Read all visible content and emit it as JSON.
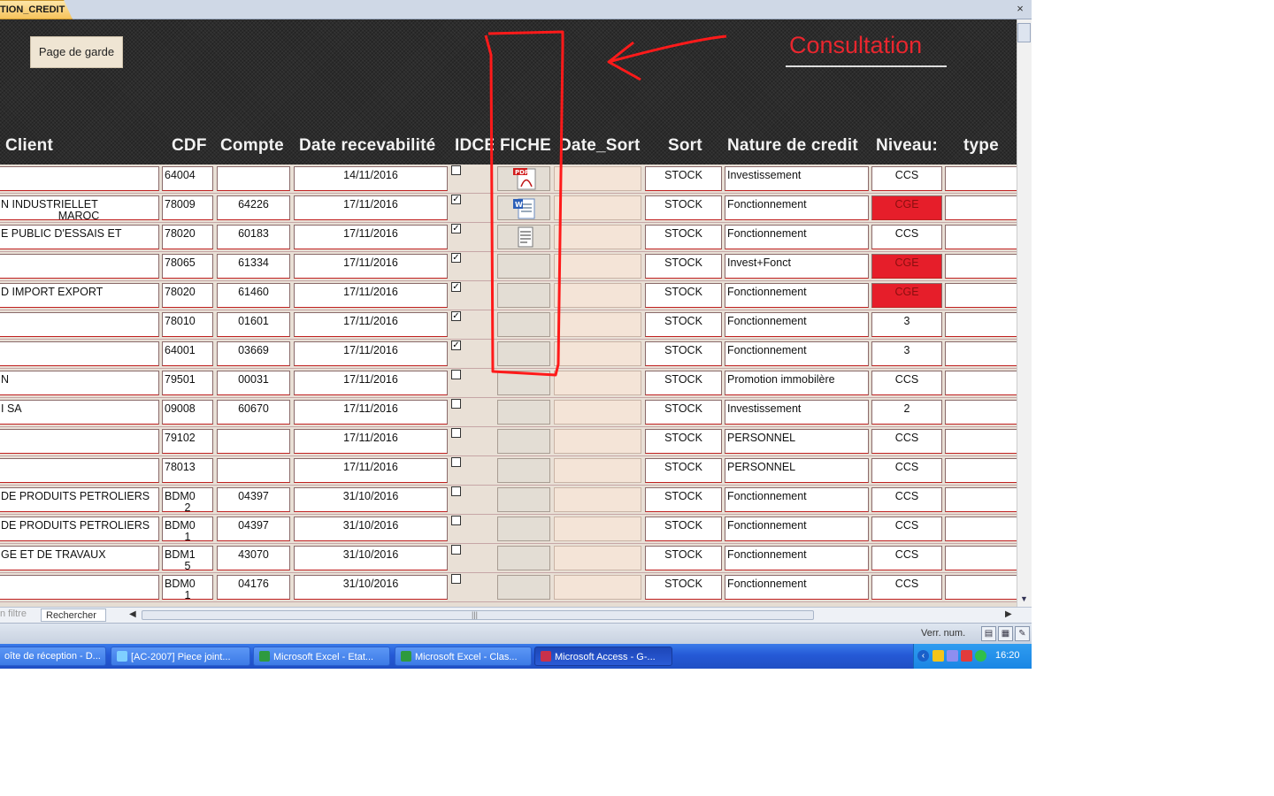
{
  "document_tab": {
    "label": "TION_CREDIT",
    "close": "×"
  },
  "form": {
    "home_button": "Page de garde",
    "annotation": "Consultation",
    "headers": [
      "Client",
      "CDF",
      "Compte",
      "Date recevabilité",
      "IDCE",
      "FICHE",
      "Date_Sort",
      "Sort",
      "Nature de credit",
      "Niveau:",
      "type"
    ],
    "rows": [
      {
        "client": "",
        "client2": "",
        "cdf": "64004",
        "cdf2": "",
        "compte": "",
        "date": "14/11/2016",
        "idce": false,
        "fiche": "pdf-icon",
        "sort": "STOCK",
        "nature": "Investissement",
        "niveau": "CCS",
        "niveau_red": false
      },
      {
        "client": "N INDUSTRIELLET",
        "client2": "MAROC",
        "cdf": "78009",
        "cdf2": "",
        "compte": "64226",
        "date": "17/11/2016",
        "idce": true,
        "fiche": "word-icon",
        "sort": "STOCK",
        "nature": "Fonctionnement",
        "niveau": "CGE",
        "niveau_red": true
      },
      {
        "client": "E PUBLIC D'ESSAIS ET",
        "client2": "",
        "cdf": "78020",
        "cdf2": "",
        "compte": "60183",
        "date": "17/11/2016",
        "idce": true,
        "fiche": "document-icon",
        "sort": "STOCK",
        "nature": "Fonctionnement",
        "niveau": "CCS",
        "niveau_red": false
      },
      {
        "client": "",
        "client2": "",
        "cdf": "78065",
        "cdf2": "",
        "compte": "61334",
        "date": "17/11/2016",
        "idce": true,
        "fiche": "",
        "sort": "STOCK",
        "nature": "Invest+Fonct",
        "niveau": "CGE",
        "niveau_red": true
      },
      {
        "client": "D IMPORT EXPORT",
        "client2": "",
        "cdf": "78020",
        "cdf2": "",
        "compte": "61460",
        "date": "17/11/2016",
        "idce": true,
        "fiche": "",
        "sort": "STOCK",
        "nature": "Fonctionnement",
        "niveau": "CGE",
        "niveau_red": true
      },
      {
        "client": "",
        "client2": "",
        "cdf": "78010",
        "cdf2": "",
        "compte": "01601",
        "date": "17/11/2016",
        "idce": true,
        "fiche": "",
        "sort": "STOCK",
        "nature": "Fonctionnement",
        "niveau": "3",
        "niveau_red": false
      },
      {
        "client": "",
        "client2": "",
        "cdf": "64001",
        "cdf2": "",
        "compte": "03669",
        "date": "17/11/2016",
        "idce": true,
        "fiche": "",
        "sort": "STOCK",
        "nature": "Fonctionnement",
        "niveau": "3",
        "niveau_red": false
      },
      {
        "client": "N",
        "client2": "",
        "cdf": "79501",
        "cdf2": "",
        "compte": "00031",
        "date": "17/11/2016",
        "idce": false,
        "fiche": "",
        "sort": "STOCK",
        "nature": "Promotion immobilère",
        "niveau": "CCS",
        "niveau_red": false
      },
      {
        "client": "I SA",
        "client2": "",
        "cdf": "09008",
        "cdf2": "",
        "compte": "60670",
        "date": "17/11/2016",
        "idce": false,
        "fiche": "",
        "sort": "STOCK",
        "nature": "Investissement",
        "niveau": "2",
        "niveau_red": false
      },
      {
        "client": "",
        "client2": "",
        "cdf": "79102",
        "cdf2": "",
        "compte": "",
        "date": "17/11/2016",
        "idce": false,
        "fiche": "",
        "sort": "STOCK",
        "nature": "PERSONNEL",
        "niveau": "CCS",
        "niveau_red": false
      },
      {
        "client": "",
        "client2": "",
        "cdf": "78013",
        "cdf2": "",
        "compte": "",
        "date": "17/11/2016",
        "idce": false,
        "fiche": "",
        "sort": "STOCK",
        "nature": "PERSONNEL",
        "niveau": "CCS",
        "niveau_red": false
      },
      {
        "client": "DE PRODUITS PETROLIERS",
        "client2": "",
        "cdf": "BDM0",
        "cdf2": "2",
        "compte": "04397",
        "date": "31/10/2016",
        "idce": false,
        "fiche": "",
        "sort": "STOCK",
        "nature": "Fonctionnement",
        "niveau": "CCS",
        "niveau_red": false
      },
      {
        "client": "DE PRODUITS PETROLIERS",
        "client2": "",
        "cdf": "BDM0",
        "cdf2": "1",
        "compte": "04397",
        "date": "31/10/2016",
        "idce": false,
        "fiche": "",
        "sort": "STOCK",
        "nature": "Fonctionnement",
        "niveau": "CCS",
        "niveau_red": false
      },
      {
        "client": "GE ET DE TRAVAUX",
        "client2": "",
        "cdf": "BDM1",
        "cdf2": "5",
        "compte": "43070",
        "date": "31/10/2016",
        "idce": false,
        "fiche": "",
        "sort": "STOCK",
        "nature": "Fonctionnement",
        "niveau": "CCS",
        "niveau_red": false
      },
      {
        "client": "",
        "client2": "",
        "cdf": "BDM0",
        "cdf2": "1",
        "compte": "04176",
        "date": "31/10/2016",
        "idce": false,
        "fiche": "",
        "sort": "STOCK",
        "nature": "Fonctionnement",
        "niveau": "CCS",
        "niveau_red": false
      }
    ]
  },
  "navigation": {
    "filter": "n filtre",
    "search": "Rechercher",
    "left_arrow": "◀",
    "right_arrow": "▶",
    "grip": "|||",
    "scroll_down": "▼"
  },
  "status": {
    "numlock": "Verr. num."
  },
  "taskbar": {
    "tasks": [
      {
        "label": "oîte de réception - D...",
        "icon": "outlook-icon",
        "color": "#f2b440",
        "active": false
      },
      {
        "label": "[AC-2007] Piece joint...",
        "icon": "ie-icon",
        "color": "#7fd0ff",
        "active": false
      },
      {
        "label": "Microsoft Excel - Etat...",
        "icon": "excel-icon",
        "color": "#2e9a3f",
        "active": false
      },
      {
        "label": "Microsoft Excel - Clas...",
        "icon": "excel-icon",
        "color": "#2e9a3f",
        "active": false
      },
      {
        "label": "Microsoft Access - G-...",
        "icon": "access-icon",
        "color": "#c8314a",
        "active": true
      }
    ],
    "clock": "16:20"
  },
  "colors": {
    "accent_red": "#e61e2a",
    "form_dark": "#2c2c2c",
    "taskbar_blue": "#2559d6"
  }
}
